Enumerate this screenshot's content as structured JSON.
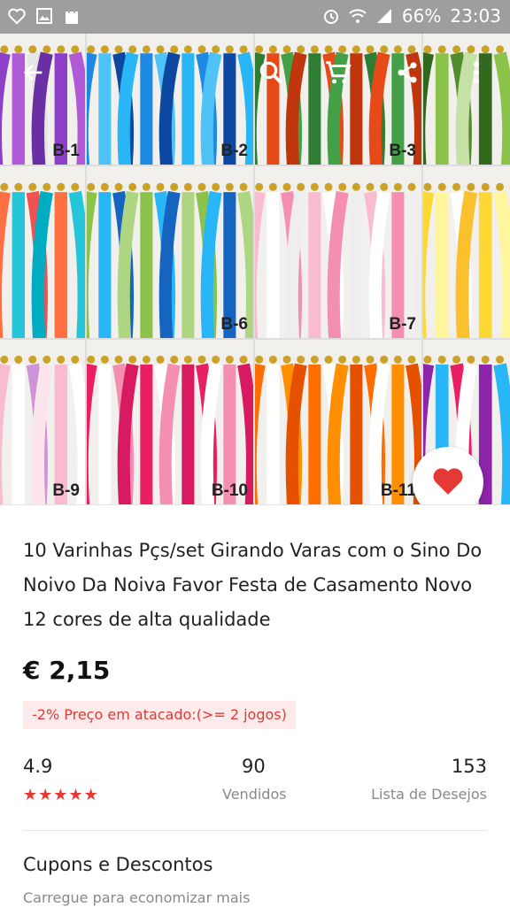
{
  "status_bar": {
    "battery": "66%",
    "time": "23:03",
    "icons": [
      "heart-outline-icon",
      "image-icon",
      "shopping-bag-icon",
      "alarm-icon",
      "wifi-icon",
      "signal-icon"
    ]
  },
  "top_actions": {
    "icons": [
      "back-arrow-icon",
      "search-icon",
      "cart-icon",
      "share-icon",
      "more-vert-icon"
    ]
  },
  "gallery": {
    "slide_count": 6,
    "active_index": 0,
    "tiles": [
      {
        "label": "B-1",
        "colors": [
          "#8e3fc9",
          "#b259d8",
          "#e6e6e6",
          "#6a2fa3"
        ]
      },
      {
        "label": "B-2",
        "colors": [
          "#1e88e5",
          "#4fc3f7",
          "#0d47a1",
          "#29b6f6"
        ]
      },
      {
        "label": "B-3",
        "colors": [
          "#2e7d32",
          "#e64a19",
          "#43a047",
          "#bf360c"
        ]
      },
      {
        "label": "",
        "colors": [
          "#33691e",
          "#8bc34a",
          "#558b2f",
          "#c5e1a5"
        ]
      },
      {
        "label": "",
        "colors": [
          "#ff7043",
          "#26c6da",
          "#ef5350",
          "#00acc1"
        ]
      },
      {
        "label": "B-6",
        "colors": [
          "#8bc34a",
          "#29b6f6",
          "#1565c0",
          "#aed581"
        ]
      },
      {
        "label": "B-7",
        "colors": [
          "#f8bbd0",
          "#ffffff",
          "#f48fb1",
          "#eeeeee"
        ]
      },
      {
        "label": "",
        "colors": [
          "#fdd835",
          "#fff59d",
          "#ffffff",
          "#fbc02d"
        ]
      },
      {
        "label": "B-9",
        "colors": [
          "#f8bbd0",
          "#ffffff",
          "#ce93d8",
          "#fce4ec"
        ]
      },
      {
        "label": "B-10",
        "colors": [
          "#e91e63",
          "#ffffff",
          "#f48fb1",
          "#d81b60"
        ]
      },
      {
        "label": "B-11",
        "colors": [
          "#ff6d00",
          "#ffffff",
          "#ff8f00",
          "#e65100"
        ]
      },
      {
        "label": "",
        "colors": [
          "#8e24aa",
          "#29b6f6",
          "#e91e63",
          "#ffffff"
        ]
      }
    ]
  },
  "product": {
    "title": "10 Varinhas Pçs/set Girando Varas com o Sino Do Noivo Da Noiva Favor Festa de Casamento Novo 12 cores de alta qualidade",
    "price": "€ 2,15",
    "wholesale": "-2% Preço em atacado:(>= 2 jogos)"
  },
  "stats": {
    "rating": "4.9",
    "stars": 5,
    "sold_value": "90",
    "sold_label": "Vendidos",
    "wishlist_value": "153",
    "wishlist_label": "Lista de Desejos"
  },
  "coupons": {
    "title": "Cupons e Descontos",
    "subtitle": "Carregue para economizar mais"
  },
  "colors": {
    "accent": "#e53935",
    "status_bar": "#9e9e9e"
  }
}
